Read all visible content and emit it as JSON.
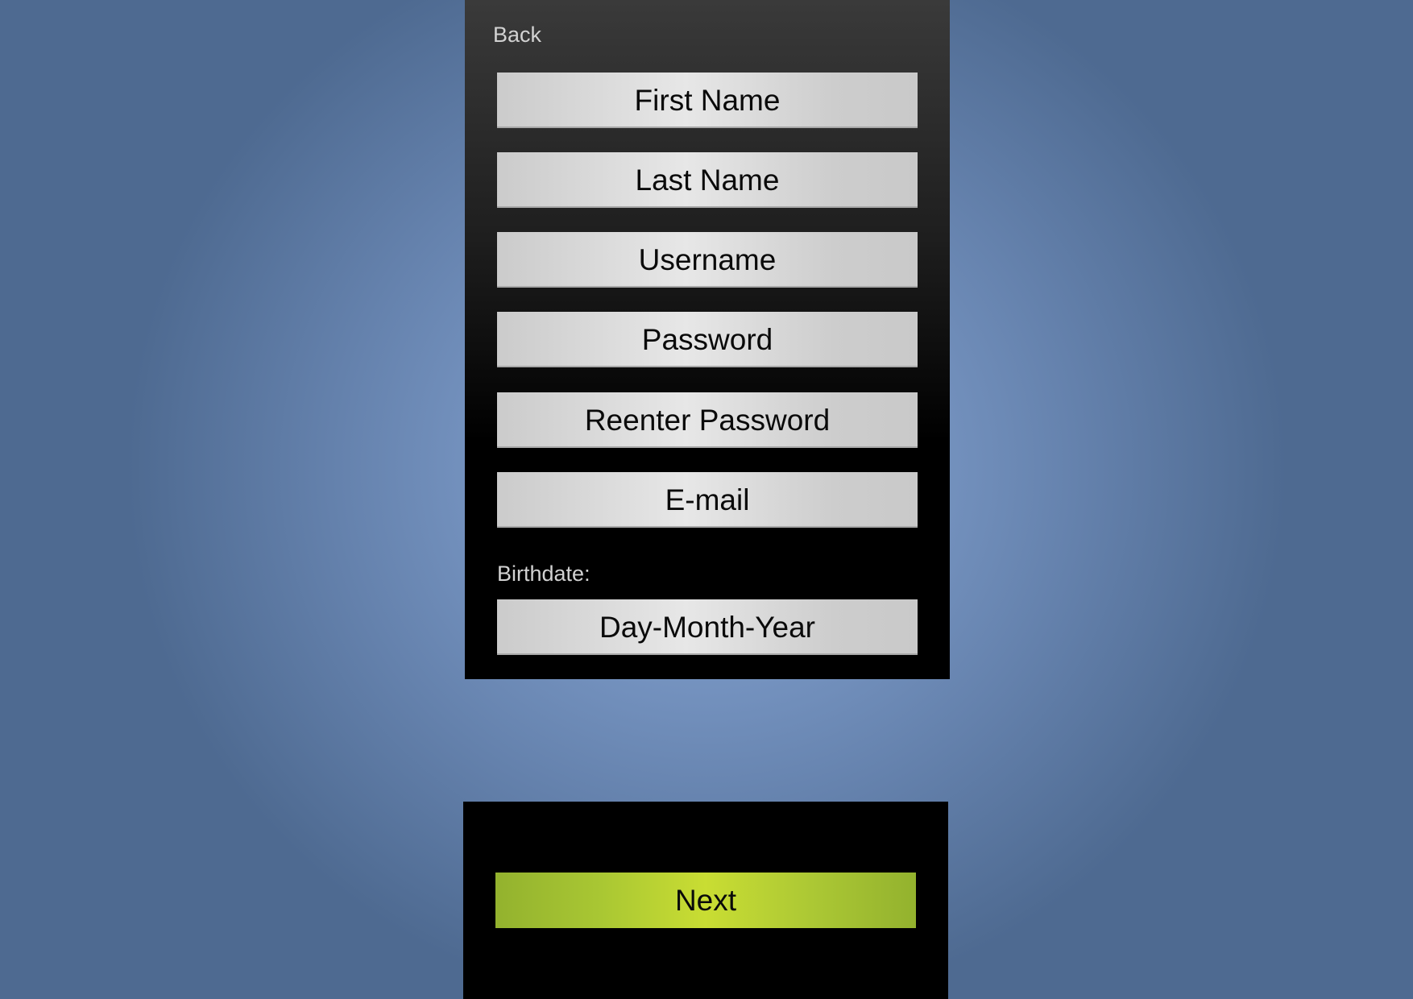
{
  "form": {
    "back_label": "Back",
    "fields": [
      {
        "placeholder": "First Name"
      },
      {
        "placeholder": "Last Name"
      },
      {
        "placeholder": "Username"
      },
      {
        "placeholder": "Password"
      },
      {
        "placeholder": "Reenter Password"
      },
      {
        "placeholder": "E-mail"
      }
    ],
    "birthdate_label": "Birthdate:",
    "birthdate_placeholder": "Day-Month-Year"
  },
  "footer": {
    "next_label": "Next"
  },
  "colors": {
    "background": "#7a98c6",
    "panel": "#000000",
    "field": "#e0e0e0",
    "next_button": "#c3d932"
  }
}
